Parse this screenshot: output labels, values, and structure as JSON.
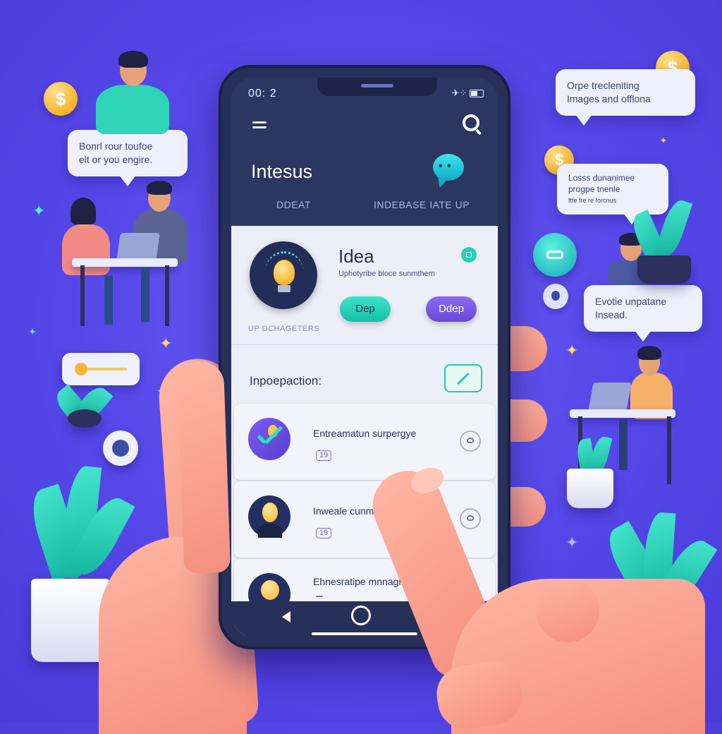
{
  "phone": {
    "status": {
      "time": "00: 2",
      "icons": "✈⁘"
    },
    "header": {
      "title": "Intesus",
      "tabs": [
        "DDEAT",
        "INDEBASE IATE UP"
      ]
    },
    "idea_card": {
      "title": "Idea",
      "subtitle": "Uphotyribe bloce sunmthem",
      "buttons": [
        "Dep",
        "Ddep"
      ],
      "label": "UP DCHAGETERS"
    },
    "section": {
      "title": "Inpoepaction:"
    },
    "list": [
      {
        "title": "Entreamatun surpergye",
        "tag": "19",
        "icon": "check-icon"
      },
      {
        "title": "Inweale cunmer",
        "tag": "19",
        "icon": "bulb-icon"
      },
      {
        "title": "Ehnesratipe mnnagrg",
        "tag": "",
        "icon": "bulb-icon"
      }
    ]
  },
  "bubbles": [
    {
      "lines": [
        "Bonrl rour toufoe",
        "elt or you engire."
      ]
    },
    {
      "lines": [
        "Orpe trecleniting",
        "Images and offlona"
      ]
    },
    {
      "lines": [
        "Losss dunanimee",
        "progpe tnenle",
        "ftfe fre re forcnus"
      ]
    },
    {
      "lines": [
        "Evotie unpatane",
        "Insead."
      ]
    }
  ],
  "coins": [
    "$",
    "$",
    "$"
  ],
  "colors": {
    "background": "#5546e8",
    "phone": "#263058",
    "accent_teal": "#23d3b8",
    "accent_purple": "#6b47db",
    "coin": "#f7b531"
  }
}
